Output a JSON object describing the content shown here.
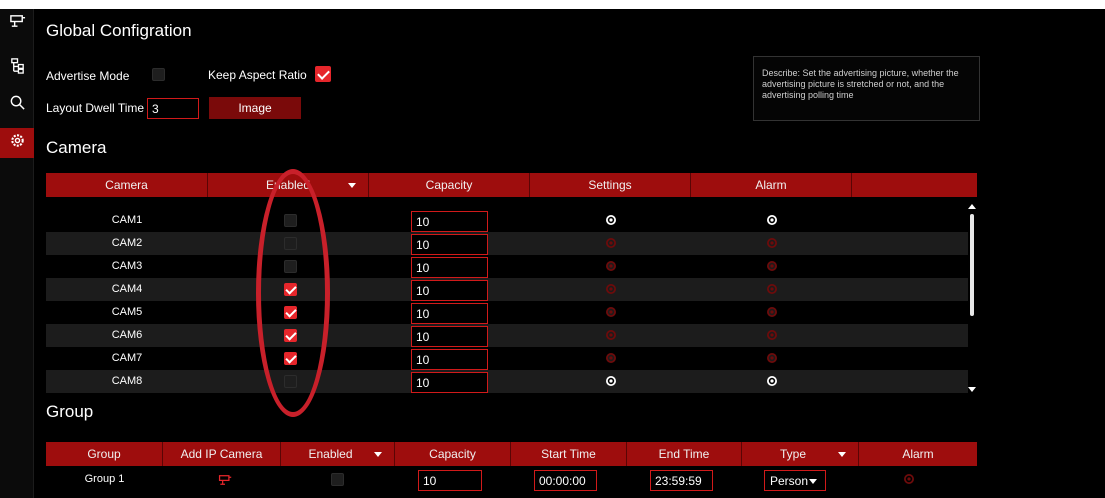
{
  "sidebar": {
    "items": [
      {
        "icon": "camera-icon"
      },
      {
        "icon": "network-tree-icon"
      },
      {
        "icon": "search-icon"
      },
      {
        "icon": "settings-gear-icon",
        "active": true
      }
    ]
  },
  "global": {
    "title": "Global Configration",
    "advertise_mode_label": "Advertise Mode",
    "advertise_mode_checked": false,
    "keep_aspect_label": "Keep Aspect Ratio",
    "keep_aspect_checked": true,
    "dwell_label": "Layout Dwell Time",
    "dwell_value": "3",
    "image_button": "Image",
    "describe": "Describe: Set the advertising picture, whether the advertising picture is stretched or not, and the advertising polling time"
  },
  "camera": {
    "title": "Camera",
    "headers": {
      "camera": "Camera",
      "enabled": "Enabled",
      "capacity": "Capacity",
      "settings": "Settings",
      "alarm": "Alarm"
    },
    "rows": [
      {
        "name": "CAM1",
        "enabled": false,
        "capacity": "10",
        "settings_active": true,
        "alarm_active": true
      },
      {
        "name": "CAM2",
        "enabled": false,
        "capacity": "10",
        "settings_active": false,
        "alarm_active": false
      },
      {
        "name": "CAM3",
        "enabled": false,
        "capacity": "10",
        "settings_active": false,
        "alarm_active": false
      },
      {
        "name": "CAM4",
        "enabled": true,
        "capacity": "10",
        "settings_active": false,
        "alarm_active": false
      },
      {
        "name": "CAM5",
        "enabled": true,
        "capacity": "10",
        "settings_active": false,
        "alarm_active": false
      },
      {
        "name": "CAM6",
        "enabled": true,
        "capacity": "10",
        "settings_active": false,
        "alarm_active": false
      },
      {
        "name": "CAM7",
        "enabled": true,
        "capacity": "10",
        "settings_active": false,
        "alarm_active": false
      },
      {
        "name": "CAM8",
        "enabled": false,
        "capacity": "10",
        "settings_active": true,
        "alarm_active": true
      }
    ]
  },
  "group": {
    "title": "Group",
    "headers": {
      "group": "Group",
      "add_ip_camera": "Add IP Camera",
      "enabled": "Enabled",
      "capacity": "Capacity",
      "start_time": "Start Time",
      "end_time": "End Time",
      "type": "Type",
      "alarm": "Alarm"
    },
    "rows": [
      {
        "name": "Group 1",
        "enabled": false,
        "capacity": "10",
        "start_time": "00:00:00",
        "end_time": "23:59:59",
        "type": "Person"
      }
    ]
  },
  "colors": {
    "accent": "#9e0d0d",
    "checkbox_on": "#e6262b",
    "input_border": "#d11a1a",
    "annotation": "#c8202a"
  }
}
